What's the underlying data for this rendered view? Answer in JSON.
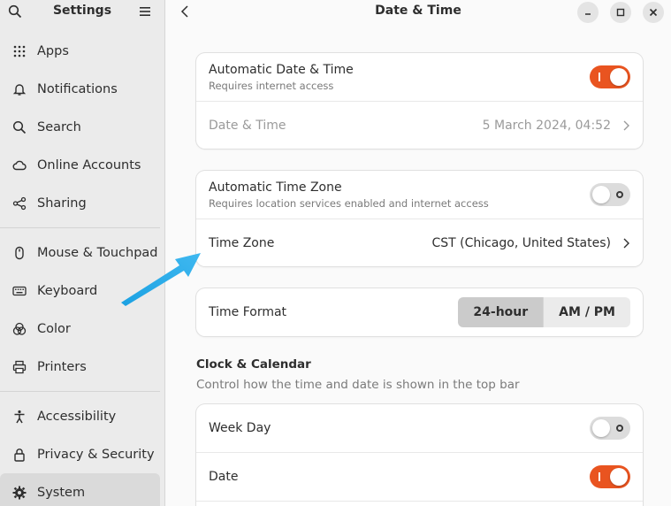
{
  "sidebar": {
    "title": "Settings",
    "search_icon": "search-icon",
    "menu_icon": "hamburger-menu-icon",
    "items": [
      {
        "label": "Apps",
        "icon": "apps-grid-icon"
      },
      {
        "label": "Notifications",
        "icon": "bell-icon"
      },
      {
        "label": "Search",
        "icon": "search-icon"
      },
      {
        "label": "Online Accounts",
        "icon": "cloud-icon"
      },
      {
        "label": "Sharing",
        "icon": "share-icon"
      },
      {
        "label": "Mouse & Touchpad",
        "icon": "mouse-icon"
      },
      {
        "label": "Keyboard",
        "icon": "keyboard-icon"
      },
      {
        "label": "Color",
        "icon": "color-icon"
      },
      {
        "label": "Printers",
        "icon": "printer-icon"
      },
      {
        "label": "Accessibility",
        "icon": "accessibility-icon"
      },
      {
        "label": "Privacy & Security",
        "icon": "lock-icon"
      },
      {
        "label": "System",
        "icon": "gear-icon",
        "active": true
      }
    ]
  },
  "header": {
    "title": "Date & Time"
  },
  "auto_datetime": {
    "label": "Automatic Date & Time",
    "subtitle": "Requires internet access",
    "enabled": true
  },
  "datetime": {
    "label": "Date & Time",
    "value": "5 March 2024, 04:52"
  },
  "auto_timezone": {
    "label": "Automatic Time Zone",
    "subtitle": "Requires location services enabled and internet access",
    "enabled": false
  },
  "timezone": {
    "label": "Time Zone",
    "value": "CST (Chicago, United States)"
  },
  "time_format": {
    "label": "Time Format",
    "options": [
      "24-hour",
      "AM / PM"
    ],
    "selected": "24-hour"
  },
  "clock_calendar": {
    "title": "Clock & Calendar",
    "subtitle": "Control how the time and date is shown in the top bar",
    "week_day": {
      "label": "Week Day",
      "enabled": false
    },
    "date": {
      "label": "Date",
      "enabled": true
    }
  },
  "colors": {
    "accent": "#e95420",
    "annotation_arrow": "#1ba1e2"
  }
}
